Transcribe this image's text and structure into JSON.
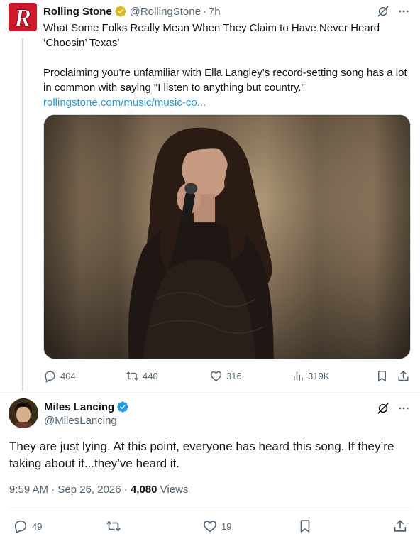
{
  "quoted_tweet": {
    "author_name": "Rolling Stone",
    "handle": "@RollingStone",
    "time": "7h",
    "headline": "What Some Folks Really Mean When They Claim to Have Never Heard ‘Choosin’ Texas’",
    "description": "Proclaiming you're unfamiliar with Ella Langley's record-setting song has a lot in common with saying \"I listen to anything but country.\"",
    "link": "rollingstone.com/music/music-co...",
    "stats": {
      "replies": "404",
      "reposts": "440",
      "likes": "316",
      "views": "319K"
    }
  },
  "main_tweet": {
    "author_name": "Miles Lancing",
    "handle": "@MilesLancing",
    "text": "They are just lying. At this point, everyone has heard this song. If they’re taking about it...they’ve heard it.",
    "timestamp": "9:59 AM · Sep 26, 2026 · ",
    "views_count": "4,080",
    "views_label": "Views",
    "stats": {
      "replies": "49",
      "reposts": "",
      "likes": "19"
    }
  },
  "icons": [
    "gold-verified-badge",
    "blue-verified-badge",
    "grok-icon",
    "more-icon",
    "reply-icon",
    "repost-icon",
    "like-icon",
    "views-icon",
    "bookmark-icon",
    "share-icon"
  ],
  "colors": {
    "text": "#0f1419",
    "muted": "#536471",
    "link": "#1d9bf0",
    "verified_blue": "#1d9bf0",
    "verified_gold": "#e2b719",
    "rolling_stone_red": "#d0182b"
  }
}
